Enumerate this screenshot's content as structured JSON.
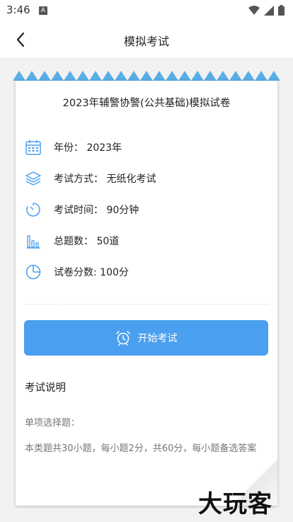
{
  "status_bar": {
    "time": "3:46",
    "notification_letter": "A"
  },
  "title_bar": {
    "title": "模拟考试"
  },
  "paper": {
    "title": "2023年辅警协警(公共基础)模拟试卷",
    "info": [
      {
        "icon": "calendar-icon",
        "text": "年份： 2023年"
      },
      {
        "icon": "layers-icon",
        "text": "考试方式： 无纸化考试"
      },
      {
        "icon": "timer-icon",
        "text": "考试时间： 90分钟"
      },
      {
        "icon": "bar-chart-icon",
        "text": "总题数： 50道"
      },
      {
        "icon": "pie-chart-icon",
        "text": "试卷分数: 100分"
      }
    ],
    "start_button": "开始考试",
    "instructions_title": "考试说明",
    "section_label": "单项选择题：",
    "section_desc": "本类题共30小题，每小题2分，共60分，每小题备选答案"
  },
  "colors": {
    "accent": "#4a9ff0",
    "triangle": "#5aaee6"
  },
  "watermark": "大玩客"
}
